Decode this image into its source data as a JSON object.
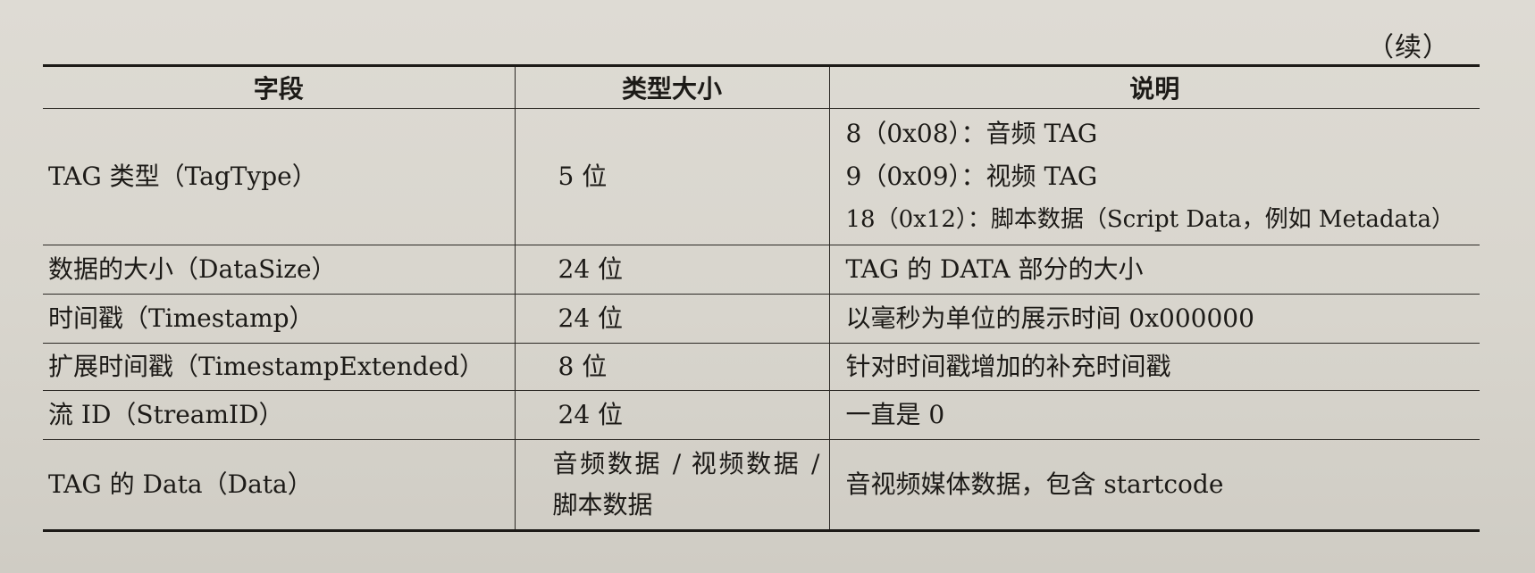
{
  "continued_label": "（续）",
  "table": {
    "headers": [
      "字段",
      "类型大小",
      "说明"
    ],
    "rows": [
      {
        "field": "TAG 类型（TagType）",
        "type": "5 位",
        "desc_lines": [
          "8（0x08）：音频 TAG",
          "9（0x09）：视频 TAG",
          "18（0x12）：脚本数据（Script Data，例如 Metadata）"
        ]
      },
      {
        "field": "数据的大小（DataSize）",
        "type": "24 位",
        "desc_lines": [
          "TAG 的 DATA 部分的大小"
        ]
      },
      {
        "field": "时间戳（Timestamp）",
        "type": "24 位",
        "desc_lines": [
          "以毫秒为单位的展示时间 0x000000"
        ]
      },
      {
        "field": "扩展时间戳（TimestampExtended）",
        "type": "8 位",
        "desc_lines": [
          "针对时间戳增加的补充时间戳"
        ]
      },
      {
        "field": "流 ID（StreamID）",
        "type": "24 位",
        "desc_lines": [
          "一直是 0"
        ]
      },
      {
        "field": "TAG 的 Data（Data）",
        "type": "音频数据 / 视频数据 / 脚本数据",
        "desc_lines": [
          "音视频媒体数据，包含 startcode"
        ]
      }
    ]
  }
}
